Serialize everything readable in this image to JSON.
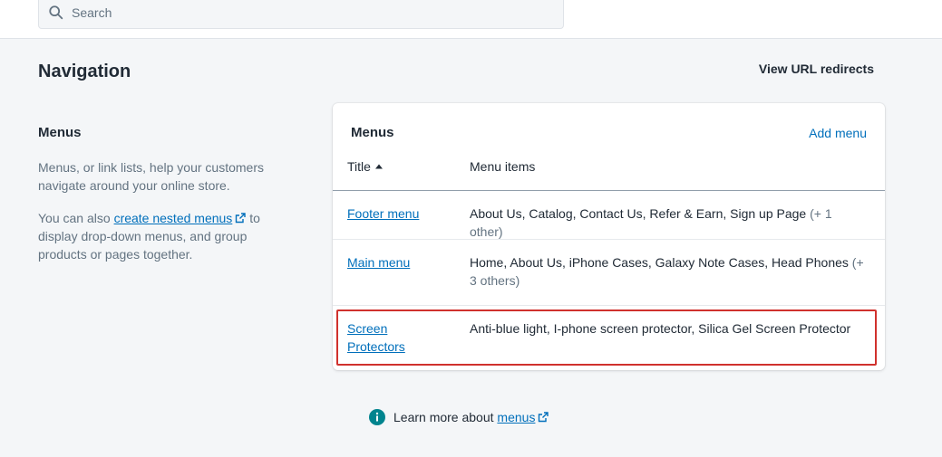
{
  "search": {
    "placeholder": "Search"
  },
  "header": {
    "title": "Navigation",
    "redirects_link": "View URL redirects"
  },
  "sidebar": {
    "heading": "Menus",
    "description": "Menus, or link lists, help your customers navigate around your online store.",
    "nested_prefix": "You can also ",
    "nested_link": "create nested menus",
    "nested_suffix": " to display drop-down menus, and group products or pages together."
  },
  "card": {
    "title": "Menus",
    "add_menu": "Add menu",
    "columns": {
      "title": "Title",
      "items": "Menu items"
    },
    "rows": [
      {
        "title": "Footer menu",
        "items": "About Us, Catalog, Contact Us, Refer & Earn, Sign up Page",
        "extra": "(+ 1 other)"
      },
      {
        "title": "Main menu",
        "items": "Home, About Us, iPhone Cases, Galaxy Note Cases, Head Phones",
        "extra": "(+ 3 others)"
      },
      {
        "title": "Screen Protectors",
        "items": "Anti-blue light, I-phone screen protector, Silica Gel Screen Protector",
        "extra": ""
      }
    ]
  },
  "footer": {
    "learn_prefix": "Learn more about ",
    "learn_link": "menus"
  },
  "colors": {
    "link": "#006fbb",
    "highlight": "#d0312d",
    "info": "#00848e"
  },
  "icons": [
    "search-icon",
    "external-link-icon",
    "sort-ascending-icon",
    "info-icon"
  ]
}
